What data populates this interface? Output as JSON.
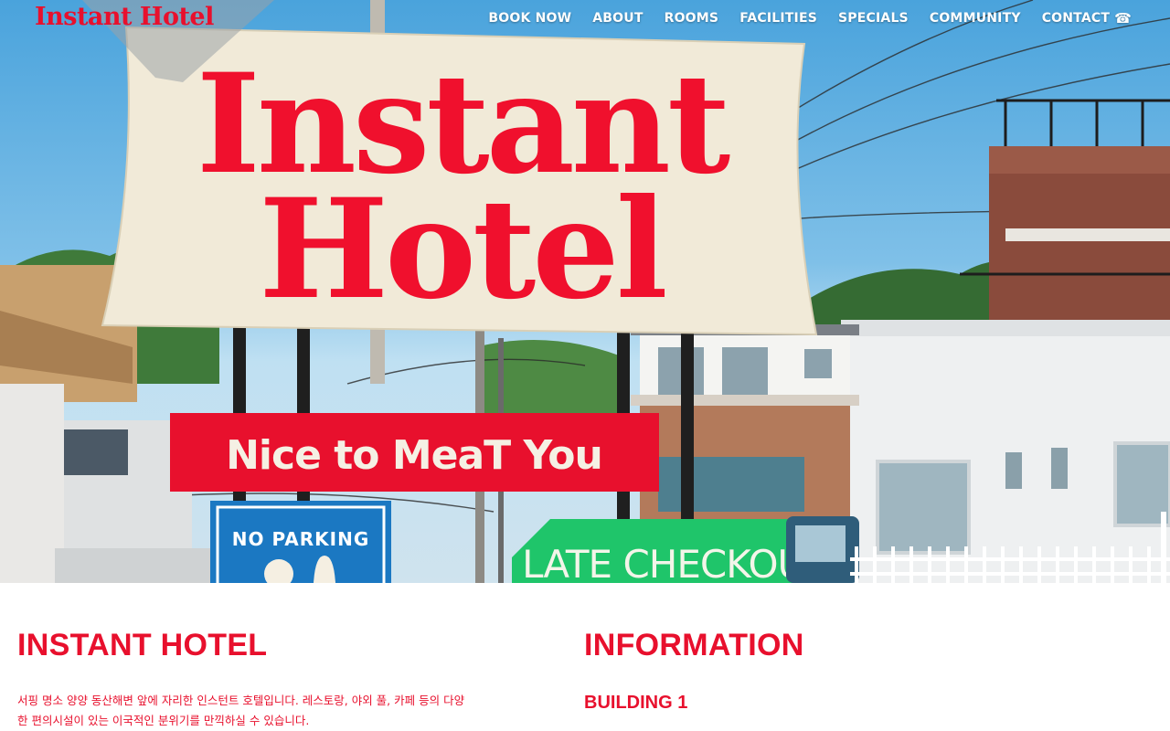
{
  "header": {
    "logo": "Instant Hotel",
    "nav": [
      {
        "id": "book",
        "label": "BOOK NOW"
      },
      {
        "id": "about",
        "label": "ABOUT"
      },
      {
        "id": "rooms",
        "label": "ROOMS"
      },
      {
        "id": "facilities",
        "label": "FACILITIES"
      },
      {
        "id": "specials",
        "label": "SPECIALS"
      },
      {
        "id": "community",
        "label": "COMMUNITY"
      },
      {
        "id": "contact",
        "label": "CONTACT",
        "icon": "phone-icon"
      }
    ]
  },
  "hero": {
    "sign_line1": "Instant",
    "sign_line2": "Hotel",
    "banner": "Nice to MeaT You",
    "parking_sign": "NO PARKING",
    "checkout_sign": "LATE CHECKOUT"
  },
  "main": {
    "left_title": "INSTANT HOTEL",
    "intro": "서핑 명소 양양 동산해변 앞에 자리한 인스턴트 호텔입니다. 레스토랑, 야외 풀, 카페 등의 다양한 편의시설이 있는 이국적인 분위기를 만끽하실 수 있습니다.",
    "right_title": "INFORMATION",
    "building": "BUILDING 1"
  },
  "colors": {
    "brand_red": "#e8102d",
    "sign_cream": "#f1ead8",
    "sky": "#4aa3dc",
    "parking_blue": "#1b78c2",
    "checkout_green": "#1fc56a"
  }
}
